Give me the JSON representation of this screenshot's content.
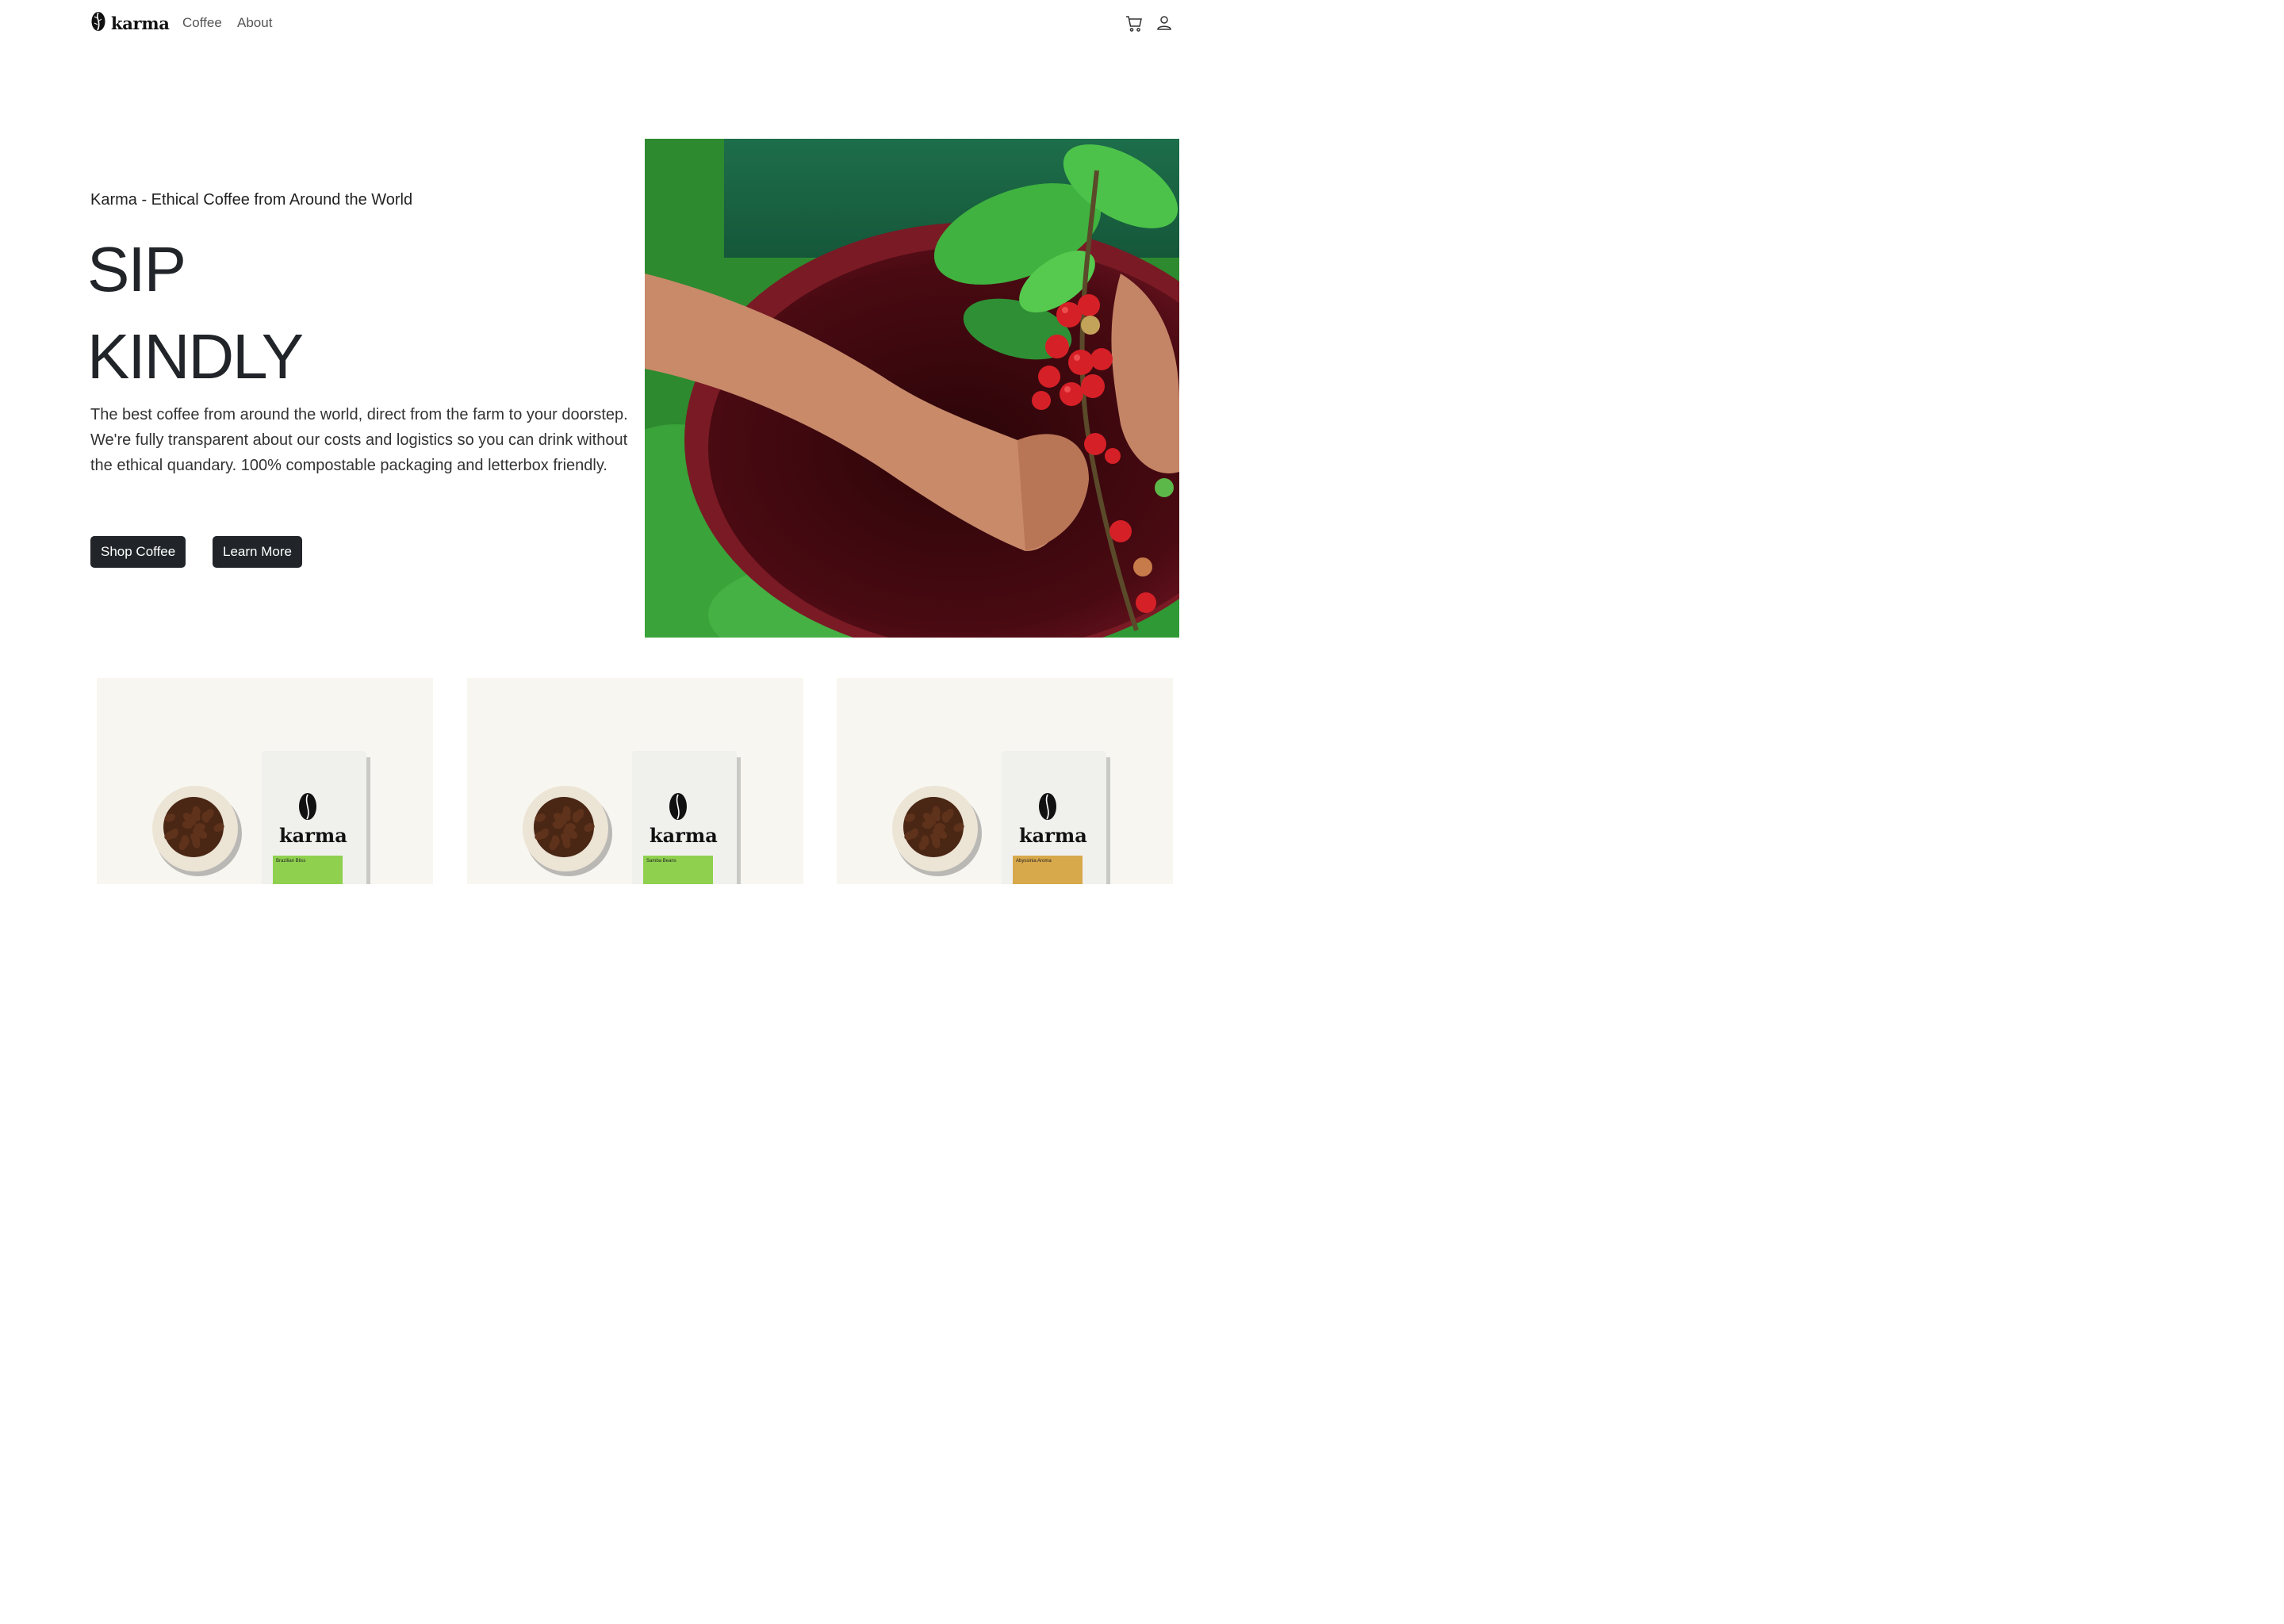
{
  "nav": {
    "brand": "karma",
    "links": [
      "Coffee",
      "About"
    ]
  },
  "hero": {
    "eyebrow": "Karma - Ethical Coffee from Around the World",
    "headline_1": "SIP",
    "headline_2": "KINDLY",
    "body": "The best coffee from around the world, direct from the farm to your doorstep. We're fully transparent about our costs and logistics so you can drink without the ethical quandary. 100% compostable packaging and letterbox friendly.",
    "primary_button": "Shop Coffee",
    "secondary_button": "Learn More"
  },
  "products": [
    {
      "bag_brand": "karma",
      "label": "Brazilian Bliss",
      "label_color": "#8fd14f"
    },
    {
      "bag_brand": "karma",
      "label": "Samba Beans",
      "label_color": "#8fd14f"
    },
    {
      "bag_brand": "karma",
      "label": "Abyssinia Aroma",
      "label_color": "#d8a94b"
    }
  ],
  "icons": {
    "logo": "coffee-leaf-icon",
    "cart": "cart-icon",
    "account": "user-icon"
  }
}
